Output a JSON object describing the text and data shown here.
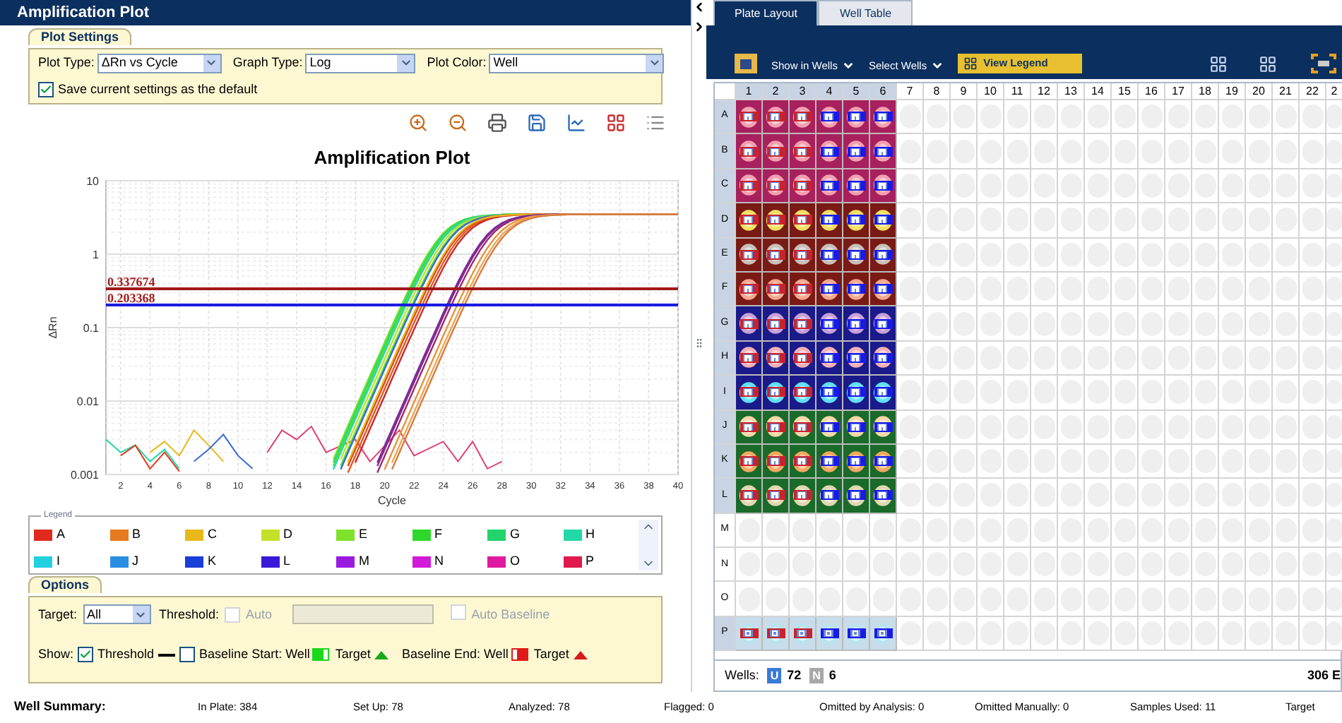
{
  "left_panel": {
    "title": "Amplification Plot",
    "plot_settings": {
      "tab": "Plot Settings",
      "fields": [
        {
          "label": "Plot Type:",
          "value": "ΔRn vs Cycle"
        },
        {
          "label": "Graph Type:",
          "value": "Log"
        },
        {
          "label": "Plot Color:",
          "value": "Well"
        }
      ],
      "save_default": {
        "label": "Save current settings as the default",
        "checked": true
      }
    },
    "chart": {
      "title": "Amplification Plot",
      "xlabel": "Cycle",
      "ylabel": "ΔRn",
      "xticks": [
        "2",
        "4",
        "6",
        "8",
        "10",
        "12",
        "14",
        "16",
        "18",
        "20",
        "22",
        "24",
        "26",
        "28",
        "30",
        "32",
        "34",
        "36",
        "38",
        "40"
      ],
      "yticks": [
        "10",
        "1",
        "0.1",
        "0.01",
        "0.001"
      ],
      "thresholds": [
        {
          "label": "0.337674",
          "color": "#a01818"
        },
        {
          "label": "0.203368",
          "color": "#1a1ae0"
        }
      ]
    },
    "legend": {
      "title": "Legend",
      "items": [
        {
          "label": "A",
          "color": "#e02a1e"
        },
        {
          "label": "B",
          "color": "#e67a1e"
        },
        {
          "label": "C",
          "color": "#e8b81a"
        },
        {
          "label": "D",
          "color": "#c6e02a"
        },
        {
          "label": "E",
          "color": "#7ee22a"
        },
        {
          "label": "F",
          "color": "#2ed82a"
        },
        {
          "label": "G",
          "color": "#22d46a"
        },
        {
          "label": "H",
          "color": "#22d8a6"
        },
        {
          "label": "I",
          "color": "#22d0e0"
        },
        {
          "label": "J",
          "color": "#2a8ee0"
        },
        {
          "label": "K",
          "color": "#1a3ed8"
        },
        {
          "label": "L",
          "color": "#3a1ad8"
        },
        {
          "label": "M",
          "color": "#9a1ae0"
        },
        {
          "label": "N",
          "color": "#d21ad8"
        },
        {
          "label": "O",
          "color": "#e01aa0"
        },
        {
          "label": "P",
          "color": "#e01a4e"
        }
      ]
    },
    "options": {
      "tab": "Options",
      "target": {
        "label": "Target:",
        "value": "All"
      },
      "threshold": {
        "label": "Threshold:",
        "auto": {
          "label": "Auto",
          "checked": false,
          "disabled": true
        },
        "field": {
          "disabled": true
        }
      },
      "auto_baseline": {
        "label": "Auto Baseline",
        "checked": false,
        "disabled": true
      },
      "show": {
        "label": "Show:",
        "threshold": {
          "label": "Threshold",
          "checked": true
        },
        "baseline_start": {
          "label": "Baseline Start: Well",
          "checked": false
        },
        "start_target": "Target",
        "baseline_end": "Baseline End: Well",
        "end_target": "Target"
      }
    }
  },
  "right_panel": {
    "tabs": [
      {
        "label": "Plate Layout",
        "selected": true
      },
      {
        "label": "Well Table",
        "selected": false
      }
    ],
    "toolbar": {
      "show_in_wells": "Show in Wells",
      "select_wells": "Select Wells",
      "view_legend": "View Legend"
    },
    "plate": {
      "columns": [
        "1",
        "2",
        "3",
        "4",
        "5",
        "6",
        "7",
        "8",
        "9",
        "10",
        "11",
        "12",
        "13",
        "14",
        "15",
        "16",
        "17",
        "18",
        "19",
        "20",
        "21",
        "22",
        "2"
      ],
      "well_targets": [
        {
          "color": "#c8232c"
        },
        {
          "color": "#c8232c"
        },
        {
          "color": "#c8232c"
        },
        {
          "color": "#1a1ae6"
        },
        {
          "color": "#1a1ae6"
        },
        {
          "color": "#1a1ae6"
        }
      ],
      "rows": [
        {
          "label": "A",
          "kind": "unknown",
          "color": "#a8205e",
          "sample": {
            "color": "#f4a0b0"
          }
        },
        {
          "label": "B",
          "kind": "unknown",
          "color": "#a8205e",
          "sample": {
            "color": "#f4a0b0"
          }
        },
        {
          "label": "C",
          "kind": "unknown",
          "color": "#a8205e",
          "sample": {
            "color": "#f4a0b0"
          }
        },
        {
          "label": "D",
          "kind": "unknown",
          "color": "#7a1a14",
          "sample": {
            "color": "#f4e060"
          }
        },
        {
          "label": "E",
          "kind": "unknown",
          "color": "#7a1a14",
          "sample": {
            "color": "#c8c0b8"
          }
        },
        {
          "label": "F",
          "kind": "unknown",
          "color": "#7a1a14",
          "sample": {
            "color": "#f4a890"
          }
        },
        {
          "label": "G",
          "kind": "unknown",
          "color": "#1a1a8a",
          "sample": {
            "color": "#c8a0d8"
          }
        },
        {
          "label": "H",
          "kind": "unknown",
          "color": "#1a1a8a",
          "sample": {
            "color": "#f4b0b8"
          }
        },
        {
          "label": "I",
          "kind": "unknown",
          "color": "#1a1a8a",
          "sample": {
            "color": "#60e0f4"
          }
        },
        {
          "label": "J",
          "kind": "unknown",
          "color": "#1a6a2a",
          "sample": {
            "color": "#f4d8a8"
          }
        },
        {
          "label": "K",
          "kind": "unknown",
          "color": "#1a6a2a",
          "sample": {
            "color": "#f4a860"
          }
        },
        {
          "label": "L",
          "kind": "unknown",
          "color": "#1a6a2a",
          "sample": {
            "color": "#e0d8b0"
          }
        },
        {
          "label": "M",
          "kind": "empty"
        },
        {
          "label": "N",
          "kind": "empty"
        },
        {
          "label": "O",
          "kind": "empty"
        },
        {
          "label": "P",
          "kind": "ntc",
          "color": "#c8dcea",
          "sample": {
            "color": "#b8e4f0"
          }
        }
      ],
      "footer": {
        "label": "Wells:",
        "counts": [
          {
            "letter": "U",
            "count": "72",
            "color": "#3a7ad8"
          },
          {
            "letter": "N",
            "count": "6",
            "color": "#a8a8a8"
          }
        ],
        "total": "306 E"
      }
    }
  },
  "status_bar": {
    "title": "Well Summary:",
    "items": [
      "In Plate: 384",
      "Set Up: 78",
      "Analyzed: 78",
      "Flagged: 0",
      "Omitted by Analysis: 0",
      "Omitted Manually: 0",
      "Samples Used: 11",
      "Target"
    ]
  }
}
